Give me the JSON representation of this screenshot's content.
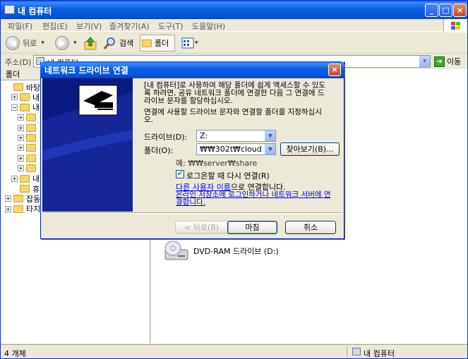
{
  "window": {
    "title": "내 컴퓨터",
    "controls": {
      "minimize": "_",
      "maximize": "□",
      "close": "×"
    }
  },
  "menu": [
    "파일(F)",
    "편집(E)",
    "보기(V)",
    "즐겨찾기(A)",
    "도구(T)",
    "도움말(H)"
  ],
  "toolbar": {
    "back_label": "뒤로",
    "search_label": "검색",
    "folders_label": "폴더",
    "back_icon": "◀",
    "forward_icon": "▶",
    "dropdown_arrow": "▾"
  },
  "address": {
    "label": "주소(D)",
    "value": "내 컴퓨터",
    "go_label": "이동",
    "dropdown_arrow": "▾"
  },
  "left_panel": {
    "header": "폴더",
    "tree": [
      {
        "label": "바탕 화",
        "indent": 0,
        "expander": ""
      },
      {
        "label": "내 문",
        "indent": 1,
        "expander": "+"
      },
      {
        "label": "내 컴",
        "indent": 1,
        "expander": "−"
      },
      {
        "label": "",
        "indent": 2,
        "expander": "+"
      },
      {
        "label": "",
        "indent": 2,
        "expander": "+"
      },
      {
        "label": "",
        "indent": 2,
        "expander": "+"
      },
      {
        "label": "",
        "indent": 2,
        "expander": "+"
      },
      {
        "label": "",
        "indent": 2,
        "expander": "+"
      },
      {
        "label": "",
        "indent": 2,
        "expander": "+"
      },
      {
        "label": "내 네",
        "indent": 1,
        "expander": "+"
      },
      {
        "label": "휴지",
        "indent": 1,
        "expander": ""
      },
      {
        "label": "잡동",
        "indent": 0,
        "expander": "+"
      },
      {
        "label": "타지",
        "indent": 0,
        "expander": "+"
      }
    ]
  },
  "main": {
    "items": [
      {
        "label": "DVD-RAM 드라이브 (D:)",
        "icon": "dvd-drive-icon"
      }
    ]
  },
  "status": {
    "count": "4 개체",
    "location": "내 컴퓨터"
  },
  "dialog": {
    "title": "네트워크 드라이브 연결",
    "close_glyph": "×",
    "intro": "[내 컴퓨터]로 사용하여 해당 폴더에 쉽게 액세스할 수 있도\n록 하려면, 공유 네트워크 폴더에 연결한 다음 그 연결에 드\n라이브 문자를 할당하십시오.",
    "instruction": "연결에 사용할 드라이브 문자와 연결할 폴더를 지정하십시\n오.",
    "drive_label": "드라이브(D):",
    "drive_value": "Z:",
    "folder_label": "폴더(O):",
    "folder_value": "₩₩302t₩cloud",
    "combo_arrow": "▼",
    "browse_label": "찾아보기(B)...",
    "example": "예: ₩₩server₩share",
    "reconnect_label": "로그온할 때 다시 연결(R)",
    "reconnect_checked": true,
    "checkmark": "✔",
    "other_user_link": "다른 사용자 이름",
    "other_user_suffix": "으로 연결합니다.",
    "online_link": "온라인 저장소에 로그인하거나 네트워크 서버에 연\n결합니다.",
    "back_button": "< 뒤로(B)",
    "finish_button": "마침",
    "cancel_button": "취소"
  }
}
